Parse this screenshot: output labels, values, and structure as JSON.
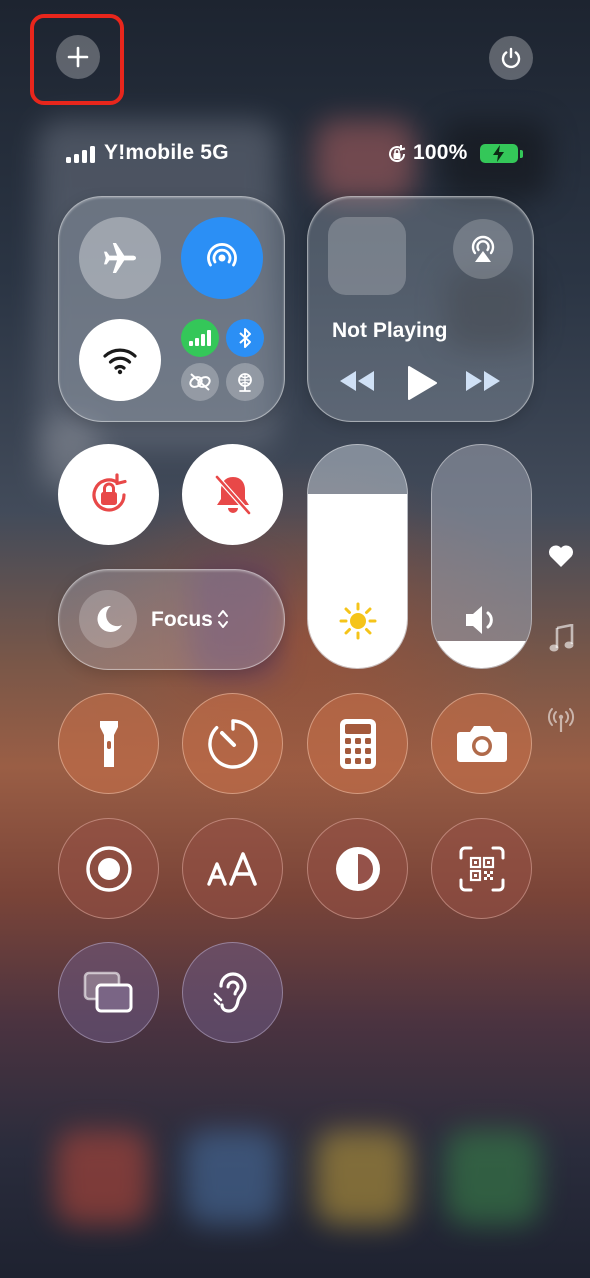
{
  "status_bar": {
    "carrier": "Y!mobile 5G",
    "battery": "100%"
  },
  "connectivity": {
    "airplane_mode": "off",
    "airdrop": "on",
    "wifi": "on",
    "cellular": "on",
    "bluetooth": "on"
  },
  "media": {
    "now_playing": "Not Playing"
  },
  "focus": {
    "label": "Focus"
  },
  "sliders": {
    "brightness_level": 0.78,
    "volume_level": 0.12
  },
  "icons": [
    "plus-icon",
    "power-icon",
    "airplane-icon",
    "airdrop-icon",
    "wifi-icon",
    "cellular-icon",
    "bluetooth-icon",
    "vpn-link-icon",
    "satellite-icon",
    "airplay-icon",
    "rewind-icon",
    "play-icon",
    "fast-forward-icon",
    "orientation-lock-icon",
    "silent-mode-icon",
    "moon-icon",
    "sun-icon",
    "speaker-icon",
    "heart-icon",
    "music-note-icon",
    "antenna-icon",
    "flashlight-icon",
    "timer-icon",
    "calculator-icon",
    "camera-icon",
    "screen-record-icon",
    "text-size-icon",
    "dark-mode-icon",
    "qr-scanner-icon",
    "screen-mirroring-icon",
    "hearing-icon"
  ],
  "colors": {
    "accent_blue": "#2b8ff5",
    "cellular_green": "#34c759",
    "battery_green": "#34c759",
    "lock_red": "#e84848",
    "highlight_red": "#e8261c",
    "sun_yellow": "#f5c41a"
  }
}
